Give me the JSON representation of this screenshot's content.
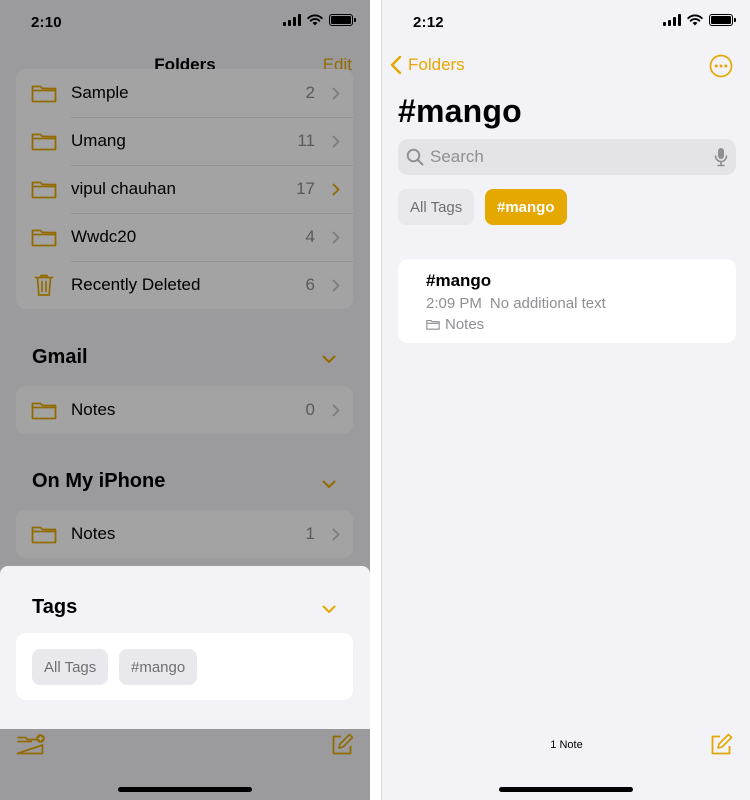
{
  "left": {
    "status": {
      "time": "2:10"
    },
    "nav": {
      "title": "Folders",
      "edit_label": "Edit"
    },
    "icloud_folders": [
      {
        "label": "Sample",
        "count": "2"
      },
      {
        "label": "Umang",
        "count": "11"
      },
      {
        "label": "vipul chauhan",
        "count": "17"
      },
      {
        "label": "Wwdc20",
        "count": "4"
      },
      {
        "label": "Recently Deleted",
        "count": "6"
      }
    ],
    "gmail": {
      "title": "Gmail",
      "folders": [
        {
          "label": "Notes",
          "count": "0"
        }
      ]
    },
    "on_my_iphone": {
      "title": "On My iPhone",
      "folders": [
        {
          "label": "Notes",
          "count": "1"
        }
      ]
    },
    "tags_popup": {
      "title": "Tags",
      "tags": [
        "All Tags",
        "#mango"
      ]
    }
  },
  "right": {
    "status": {
      "time": "2:12"
    },
    "nav": {
      "back_label": "Folders"
    },
    "title": "#mango",
    "search": {
      "placeholder": "Search"
    },
    "tags": {
      "all": "All Tags",
      "active": "#mango"
    },
    "note": {
      "title": "#mango",
      "time": "2:09 PM",
      "preview": "No additional text",
      "folder": "Notes"
    },
    "footer": {
      "count_label": "1 Note"
    }
  },
  "colors": {
    "accent": "#e5a800",
    "background": "#f2f2f7",
    "card": "#ffffff",
    "secondary_text": "#8e8e93"
  },
  "icons": [
    "folder-icon",
    "trash-icon",
    "chevron-right-icon",
    "chevron-down-icon",
    "new-folder-icon",
    "compose-icon",
    "back-chevron-icon",
    "more-icon",
    "search-icon",
    "microphone-icon",
    "wifi-icon",
    "battery-icon",
    "signal-icon"
  ]
}
